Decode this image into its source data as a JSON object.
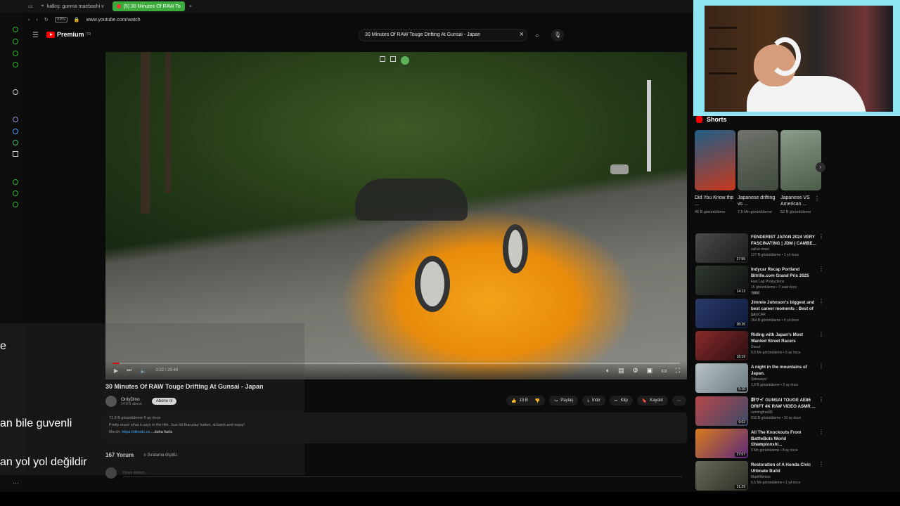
{
  "browser": {
    "tabs": [
      {
        "label": "kalkış: gunma maebashi v",
        "active": false
      },
      {
        "label": "(5) 30 Minutes Of RAW To",
        "active": true
      }
    ],
    "url": "www.youtube.com/watch",
    "vpn_label": "VPN"
  },
  "youtube": {
    "logo_text": "Premium",
    "logo_sup": "TR",
    "search_value": "30 Minutes Of RAW Touge Drifting At Gunsai - Japan"
  },
  "player": {
    "time": "0:22 / 29:49",
    "progress_fraction": 0.012
  },
  "overlay": {
    "lines": [
      "e",
      "an bile guvenli",
      "an yol yol değildir"
    ]
  },
  "video": {
    "title": "30 Minutes Of RAW Touge Drifting At Gunsai - Japan",
    "channel": "OnlyDino",
    "subscribers": "14,8 B abone",
    "subscribe_label": "Abone ol",
    "likes": "13 B",
    "share_label": "Paylaş",
    "download_label": "İndir",
    "clip_label": "Klip",
    "save_label": "Kaydet",
    "desc_meta": "71,9 B görüntüleme  9 ay önce",
    "desc_text": "Pretty much what it says in the title. Just hit that play button, sit back and enjoy!",
    "desc_merch_prefix": "Merch:",
    "desc_link": "https://dinodc.co",
    "desc_more": "...daha fazla",
    "comments_count": "167 Yorum",
    "sort_label": "Sıralama ölçütü:",
    "add_comment": "Yorum ekleyin..."
  },
  "shorts": {
    "header": "Shorts",
    "items": [
      {
        "title": "Did You Know the ...",
        "views": "45 B görüntüleme",
        "colors": [
          "#1f5d86",
          "#c7391d"
        ]
      },
      {
        "title": "Japanese drifting vs ...",
        "views": "7,5 Mn görüntüleme",
        "colors": [
          "#70736b",
          "#3f4a3d"
        ]
      },
      {
        "title": "Japanese VS American ...",
        "views": "52 B görüntüleme",
        "colors": [
          "#8a9c8a",
          "#4b5d47"
        ]
      }
    ]
  },
  "recommended": [
    {
      "title": "FENDERIST JAPAN 2024 VERY FASCINATING | JDM | CAMBE...",
      "channel": "saKet down",
      "meta": "127 B görüntüleme • 1 yıl önce",
      "duration": "37:56",
      "colors": [
        "#4b4b4b",
        "#1c1c1c"
      ],
      "badge": ""
    },
    {
      "title": "Indycar Recap Portland Bitrille.com Grand Prix 2025",
      "channel": "Fast Lap Productions",
      "meta": "15 görüntüleme • 7 saat önce",
      "duration": "14:13",
      "colors": [
        "#2f3b2f",
        "#111"
      ],
      "badge": "Yeni"
    },
    {
      "title": "Jimmie Johnson's biggest and best career moments : Best of ...",
      "channel": "NASCAR",
      "meta": "264 B görüntüleme • 4 yıl önce",
      "duration": "38:26",
      "colors": [
        "#2a3b6a",
        "#0f1a3a"
      ],
      "badge": ""
    },
    {
      "title": "Riding with Japan's Most Wanted Street Racers",
      "channel": "Donut",
      "meta": "9,5 Mn görüntüleme • 5 ay önce",
      "duration": "18:19",
      "colors": [
        "#8a2a2a",
        "#2a0f12"
      ],
      "badge": ""
    },
    {
      "title": "A night in the mountains of Japan.",
      "channel": "Sideways!",
      "meta": "1,9 B görüntüleme • 2 ay önce",
      "duration": "5:16",
      "colors": [
        "#b8c2c6",
        "#6b7a80"
      ],
      "badge": ""
    },
    {
      "title": "群サイ GUNSAI TOUGE AE86 DRIFT 4K RAW VIDEO ASMR ...",
      "channel": "runningfree86",
      "meta": "810 B görüntüleme • 10 ay önce",
      "duration": "9:02",
      "colors": [
        "#b8474a",
        "#3b4a68"
      ],
      "badge": ""
    },
    {
      "title": "All The Knockouts From BattleBots World Championshi...",
      "channel": "BattleBots",
      "meta": "9 Mn görüntüleme • 8 ay önce",
      "duration": "27:07",
      "colors": [
        "#d97a1e",
        "#5a2a7a"
      ],
      "badge": ""
    },
    {
      "title": "Restoration of A Honda Civic Ultimate Build",
      "channel": "Mad4Motors",
      "meta": "6,5 Mn görüntüleme • 1 yıl önce",
      "duration": "31:29",
      "colors": [
        "#6a6a5a",
        "#2e2e26"
      ],
      "badge": ""
    }
  ]
}
